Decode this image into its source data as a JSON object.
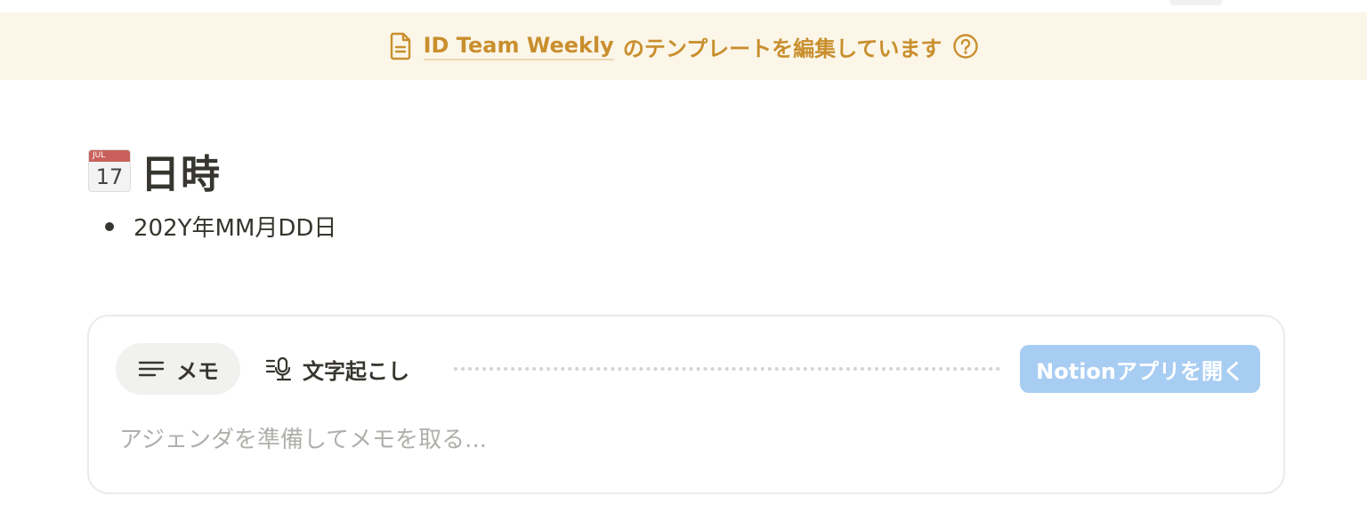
{
  "banner": {
    "icon": "document-icon",
    "template_name": "ID Team Weekly",
    "message": "のテンプレートを編集しています",
    "help_icon": "help-circle-icon",
    "color": "#c98f2e",
    "background": "#fbf6e8"
  },
  "section": {
    "icon": "calendar-icon",
    "calendar_month": "JUL",
    "calendar_day": "17",
    "title": "日時",
    "bullet": "202Y年MM月DD日"
  },
  "meeting_notes": {
    "tabs": [
      {
        "label": "メモ",
        "icon": "lines-icon",
        "selected": true
      },
      {
        "label": "文字起こし",
        "icon": "transcript-mic-icon",
        "selected": false
      }
    ],
    "open_app_button": "Notionアプリを開く",
    "open_app_button_color": "#a8cdf3",
    "placeholder": "アジェンダを準備してメモを取る..."
  }
}
